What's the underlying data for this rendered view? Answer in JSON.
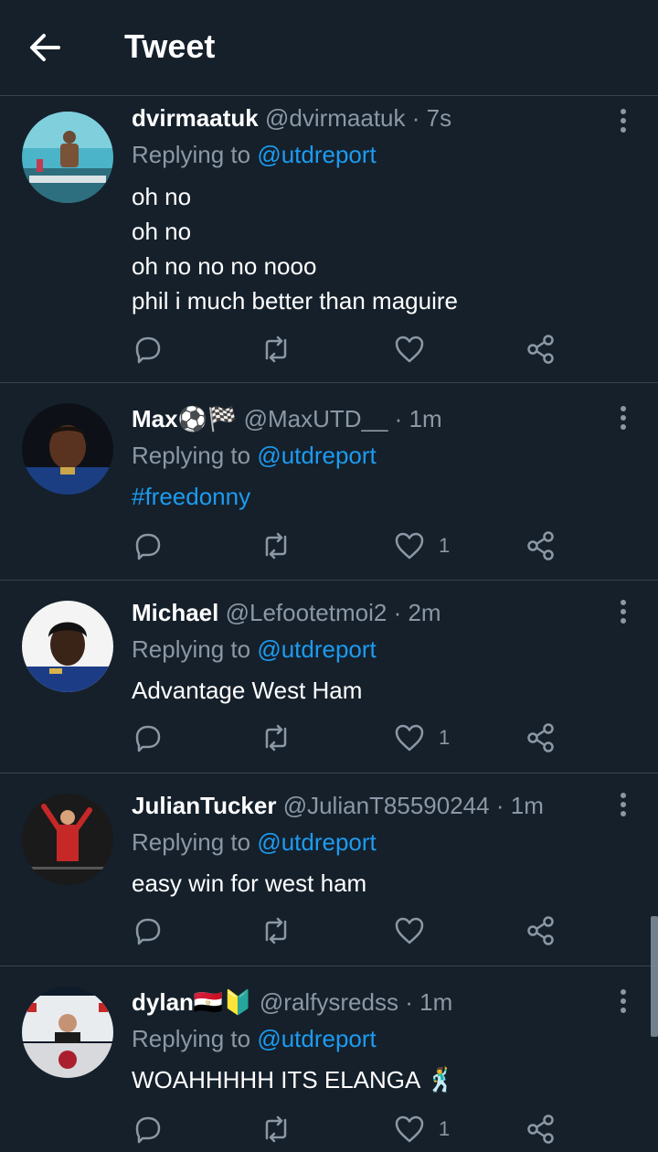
{
  "header": {
    "title": "Tweet",
    "back_icon": "arrow-left-icon"
  },
  "colors": {
    "background": "#15202b",
    "link": "#1d9bf0",
    "muted": "#8b98a5",
    "divider": "#38444d"
  },
  "tweets": [
    {
      "name": "dvirmaatuk",
      "handle": "@dvirmaatuk",
      "sep": "·",
      "time": "7s",
      "replying_prefix": "Replying to ",
      "replying_to": "@utdreport",
      "lines": [
        "oh no",
        "oh no",
        "oh no no no nooo",
        "phil i much better than maguire"
      ],
      "likes": ""
    },
    {
      "name": "Max⚽🏁",
      "handle": "@MaxUTD__",
      "sep": "·",
      "time": "1m",
      "replying_prefix": "Replying to ",
      "replying_to": "@utdreport",
      "lines": [
        "#freedonny"
      ],
      "likes": "1"
    },
    {
      "name": "Michael",
      "handle": "@Lefootetmoi2",
      "sep": "·",
      "time": "2m",
      "replying_prefix": "Replying to ",
      "replying_to": "@utdreport",
      "lines": [
        "Advantage West Ham"
      ],
      "likes": "1"
    },
    {
      "name": "JulianTucker",
      "handle": "@JulianT85590244",
      "sep": "·",
      "time": "1m",
      "replying_prefix": "Replying to ",
      "replying_to": "@utdreport",
      "lines": [
        "easy win for west ham"
      ],
      "likes": ""
    },
    {
      "name": "dylan🇪🇬🔰",
      "handle": "@ralfysredss",
      "sep": "·",
      "time": "1m",
      "replying_prefix": "Replying to ",
      "replying_to": "@utdreport",
      "lines": [
        "WOAHHHHH ITS ELANGA 🕺"
      ],
      "likes": "1"
    }
  ]
}
